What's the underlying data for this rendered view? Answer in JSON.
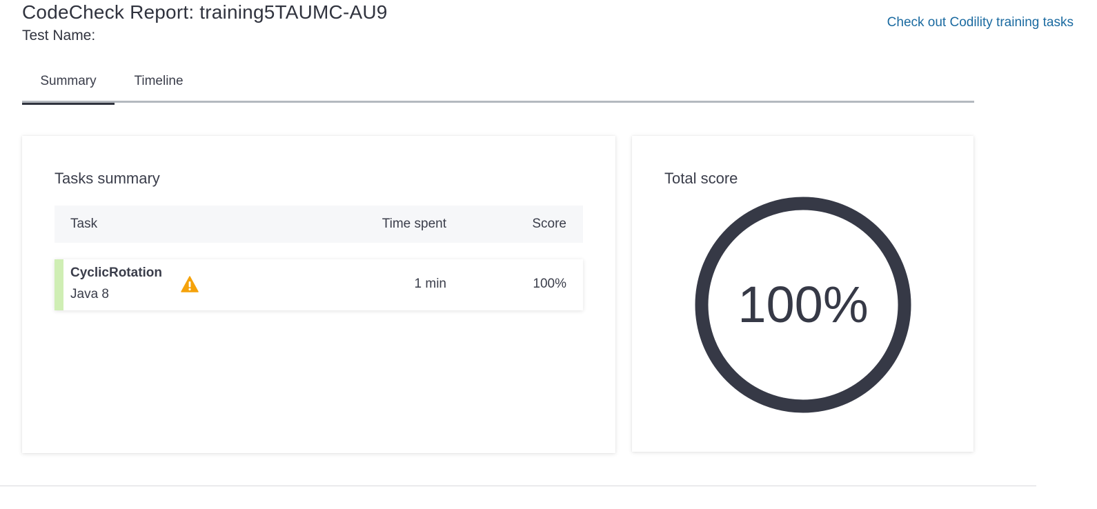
{
  "header": {
    "title": "CodeCheck Report: training5TAUMC-AU9",
    "test_name_label": "Test Name:",
    "training_link": "Check out Codility training tasks"
  },
  "tabs": [
    {
      "label": "Summary",
      "active": true
    },
    {
      "label": "Timeline",
      "active": false
    }
  ],
  "tasks_summary": {
    "title": "Tasks summary",
    "columns": {
      "task": "Task",
      "time": "Time spent",
      "score": "Score"
    },
    "rows": [
      {
        "name": "CyclicRotation",
        "language": "Java 8",
        "time": "1 min",
        "score": "100%",
        "icon": "warning-icon",
        "status_color": "#cfeeb4"
      }
    ]
  },
  "total_score": {
    "title": "Total score",
    "value": "100%",
    "fraction": 1.0,
    "ring_color": "#363946"
  },
  "colors": {
    "link": "#1a6aa0",
    "warning": "#f5a20a",
    "text": "#3a3d4a"
  }
}
